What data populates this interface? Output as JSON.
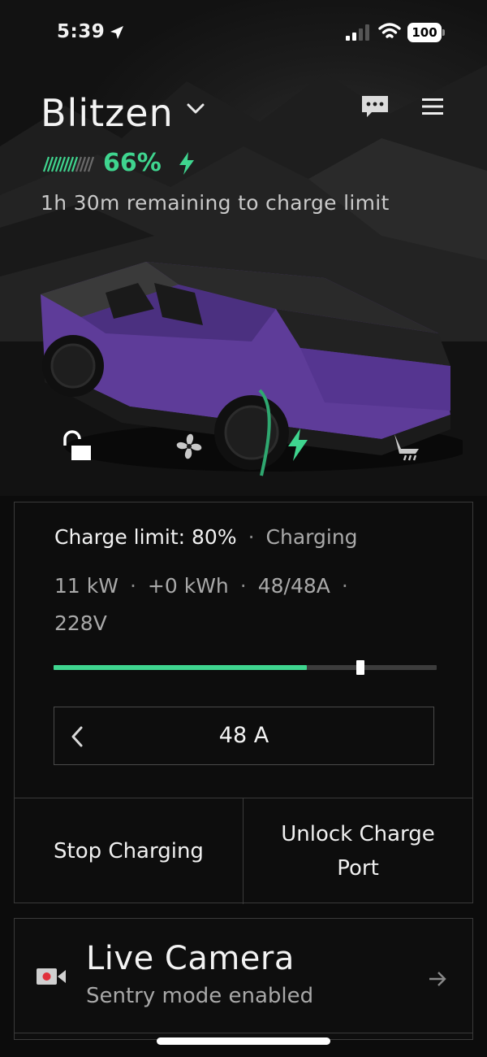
{
  "status_bar": {
    "time": "5:39",
    "battery": "100"
  },
  "header": {
    "vehicle_name": "Blitzen",
    "battery_percent": "66%",
    "remaining_text": "1h 30m remaining to charge limit"
  },
  "quick_controls": [
    "lock-icon",
    "fan-icon",
    "charge-icon",
    "seat-icon"
  ],
  "charging": {
    "limit_label": "Charge limit: 80%",
    "separator": "·",
    "state": "Charging",
    "stats": [
      "11 kW",
      "+0 kWh",
      "48/48A",
      "228V"
    ],
    "battery_level": 0.66,
    "limit_level": 0.8,
    "amps": "48 A",
    "stop_label": "Stop Charging",
    "unlock_label": "Unlock Charge Port"
  },
  "camera": {
    "title": "Live Camera",
    "subtitle": "Sentry mode enabled"
  },
  "colors": {
    "accent": "#3fd58f",
    "background": "#0c0c0c",
    "car_body": "#5e3c99"
  }
}
